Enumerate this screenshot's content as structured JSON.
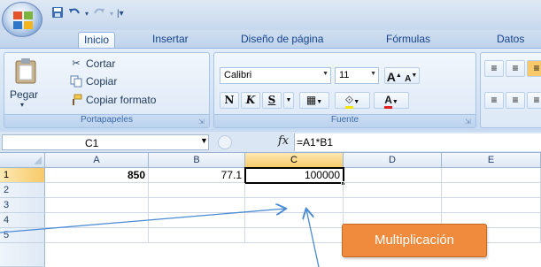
{
  "quick_access": {
    "save_icon": "save-icon",
    "undo_icon": "undo-icon",
    "redo_icon": "redo-icon",
    "customize_icon": "customize-quick-access-icon"
  },
  "tabs": [
    {
      "label": "Inicio",
      "active": true
    },
    {
      "label": "Insertar",
      "active": false
    },
    {
      "label": "Diseño de página",
      "active": false
    },
    {
      "label": "Fórmulas",
      "active": false
    },
    {
      "label": "Datos",
      "active": false
    }
  ],
  "ribbon": {
    "clipboard": {
      "label": "Portapapeles",
      "paste": "Pegar",
      "cut": "Cortar",
      "copy": "Copiar",
      "format_painter": "Copiar formato"
    },
    "font": {
      "label": "Fuente",
      "font_name": "Calibri",
      "font_size": "11",
      "bold": "N",
      "italic": "K",
      "underline": "S",
      "grow": "A",
      "shrink": "A"
    }
  },
  "formula_bar": {
    "name_box": "C1",
    "fx": "fx",
    "formula": "=A1*B1"
  },
  "grid": {
    "columns": [
      "A",
      "B",
      "C",
      "D",
      "E"
    ],
    "rows": [
      "1",
      "2",
      "3",
      "4",
      "5"
    ],
    "cells": {
      "A1": "850",
      "B1": "77.1",
      "C1": "100000"
    },
    "active_cell": "C1"
  },
  "annotation": {
    "text": "Multiplicación"
  },
  "colors": {
    "ribbon_bg": "#d4e3f5",
    "selected_header": "#f7c96a",
    "annotation_bg": "#f08a3c",
    "arrow": "#4a8bd6"
  }
}
